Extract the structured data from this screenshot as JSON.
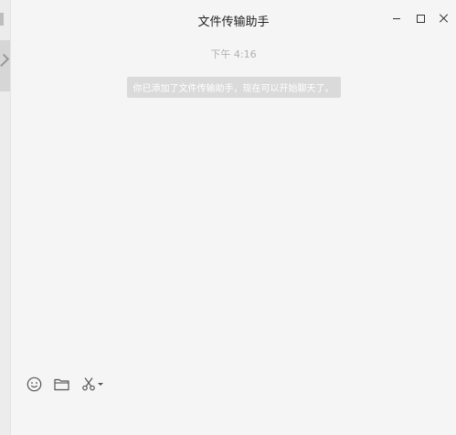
{
  "window": {
    "title": "文件传输助手",
    "controls": {
      "minimize_icon": "minimize-icon",
      "maximize_icon": "maximize-icon",
      "close_icon": "close-icon"
    }
  },
  "conversation": {
    "timestamp": "下午 4:16",
    "system_message": "你已添加了文件传输助手，现在可以开始聊天了。"
  },
  "input_toolbar": {
    "emoji_icon": "emoji-icon",
    "folder_icon": "folder-icon",
    "screenshot_icon": "scissors-icon"
  },
  "colors": {
    "background": "#f5f5f5",
    "system_bubble": "#dadada",
    "timestamp_text": "#b0b0b0",
    "icon_stroke": "#555555"
  }
}
